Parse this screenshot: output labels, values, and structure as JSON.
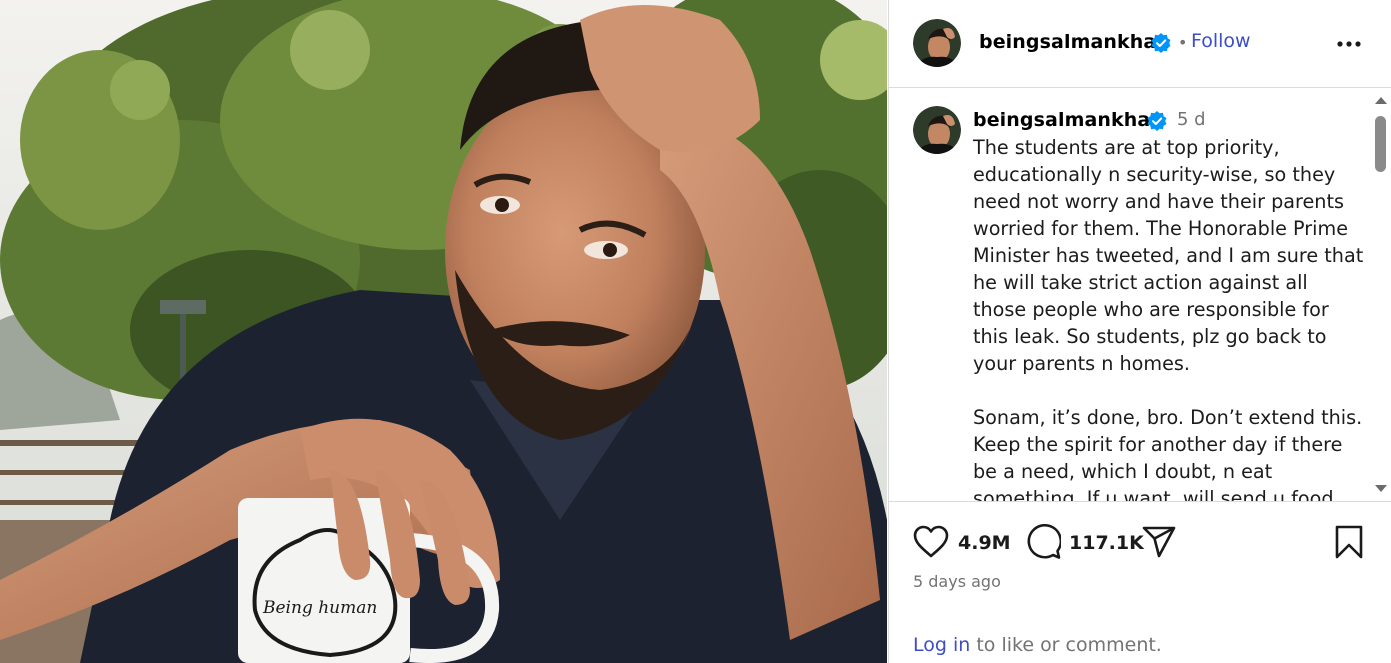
{
  "post": {
    "username": "beingsalmankhan",
    "follow_label": "Follow",
    "separator": "•",
    "time_short": "5 d",
    "caption": "The students are at top priority,\neducationally n security-wise, so they\nneed not worry and have their parents\nworried for them. The Honorable Prime\nMinister has tweeted, and I am sure that\nhe will take strict action against all\nthose people who are responsible for\nthis leak. So students, plz go back to\nyour parents n homes.\n\nSonam, it’s done, bro. Don’t extend this.\nKeep the spirit for another day if there\nbe a need, which I doubt, n eat\nsomething. If u want, will send u food",
    "likes": "4.9M",
    "comments": "117.1K",
    "posted_ago": "5 days ago",
    "login_link": "Log in",
    "login_rest": " to like or comment.",
    "mug_text": "Being human"
  },
  "icons": {
    "verified": "verified-badge-icon",
    "more": "more-options-icon",
    "like": "heart-icon",
    "comment": "comment-bubble-icon",
    "share": "paper-plane-icon",
    "save": "bookmark-icon"
  },
  "colors": {
    "link_blue": "#3c4ec7",
    "verified_blue": "#0095f6",
    "muted_text": "#737373",
    "divider": "#dbdbdb"
  }
}
